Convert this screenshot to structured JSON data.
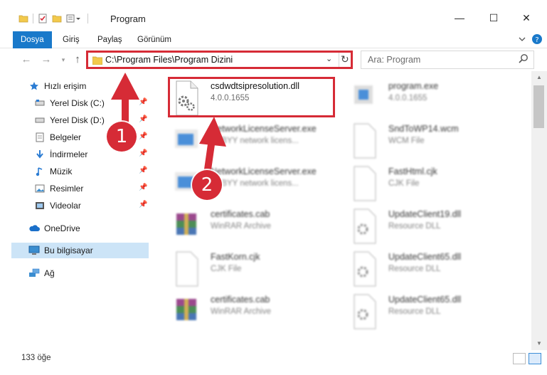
{
  "window": {
    "title": "Program",
    "controls": {
      "minimize": "—",
      "maximize": "☐",
      "close": "✕"
    }
  },
  "ribbon": {
    "tabs": [
      "Dosya",
      "Giriş",
      "Paylaş",
      "Görünüm"
    ],
    "active_tab": "Dosya"
  },
  "addressbar": {
    "path": "C:\\Program Files\\Program Dizini",
    "search_placeholder": "Ara: Program"
  },
  "sidebar": {
    "quick_access": "Hızlı erişim",
    "items": [
      {
        "label": "Yerel Disk (C:)",
        "icon": "drive-icon",
        "pinned": true
      },
      {
        "label": "Yerel Disk (D:)",
        "icon": "drive-icon",
        "pinned": true
      },
      {
        "label": "Belgeler",
        "icon": "documents-icon",
        "pinned": true
      },
      {
        "label": "İndirmeler",
        "icon": "download-icon",
        "pinned": true
      },
      {
        "label": "Müzik",
        "icon": "music-icon",
        "pinned": true
      },
      {
        "label": "Resimler",
        "icon": "pictures-icon",
        "pinned": true
      },
      {
        "label": "Videolar",
        "icon": "videos-icon",
        "pinned": true
      }
    ],
    "onedrive": "OneDrive",
    "this_pc": "Bu bilgisayar",
    "network": "Ağ"
  },
  "files": [
    {
      "name": "csdwdtsipresolution.dll",
      "meta": "4.0.0.1655",
      "icon": "dll-gear-icon",
      "highlighted": true
    },
    {
      "name": "program.exe",
      "meta": "4.0.0.1655",
      "icon": "exe-icon"
    },
    {
      "name": "NetworkLicenseServer.exe",
      "meta": "ABBYY network licens...",
      "icon": "exe-blue-icon"
    },
    {
      "name": "SndToWP14.wcm",
      "meta": "WCM File",
      "icon": "blank-file-icon"
    },
    {
      "name": "NetworkLicenseServer.exe",
      "meta": "ABBYY network licens...",
      "icon": "exe-blue-icon"
    },
    {
      "name": "FastHtml.cjk",
      "meta": "CJK File",
      "icon": "blank-file-icon"
    },
    {
      "name": "certificates.cab",
      "meta": "WinRAR Archive",
      "icon": "winrar-icon"
    },
    {
      "name": "UpdateClient19.dll",
      "meta": "Resource DLL",
      "icon": "dll-gear-icon"
    },
    {
      "name": "FastKorn.cjk",
      "meta": "CJK File",
      "icon": "blank-file-icon"
    },
    {
      "name": "UpdateClient65.dll",
      "meta": "Resource DLL",
      "icon": "dll-gear-icon"
    },
    {
      "name": "certificates.cab",
      "meta": "WinRAR Archive",
      "icon": "winrar-icon"
    },
    {
      "name": "UpdateClient65.dll",
      "meta": "Resource DLL",
      "icon": "dll-gear-icon"
    }
  ],
  "statusbar": {
    "item_count": "133 öğe"
  },
  "annotations": {
    "step1": "1",
    "step2": "2"
  },
  "colors": {
    "accent": "#1979ca",
    "annotation": "#d62b36",
    "selection": "#cce4f7"
  }
}
